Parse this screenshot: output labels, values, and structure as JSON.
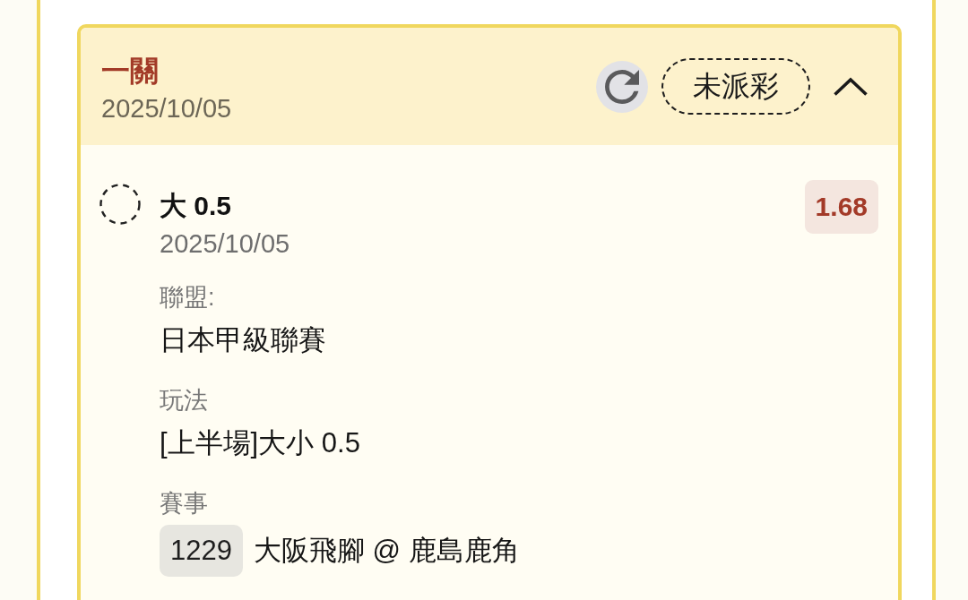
{
  "bet": {
    "title": "一關",
    "date": "2025/10/05",
    "status": "未派彩",
    "expanded": true,
    "selections": [
      {
        "pick": "大 0.5",
        "date": "2025/10/05",
        "odds": "1.68",
        "fields": [
          {
            "kind": "text",
            "label": "聯盟:",
            "value": "日本甲級聯賽"
          },
          {
            "kind": "text",
            "label": "玩法",
            "value": "[上半場]大小 0.5"
          },
          {
            "kind": "match",
            "label": "賽事",
            "match_no": "1229",
            "value": "大阪飛腳 @ 鹿島鹿角"
          }
        ]
      }
    ]
  }
}
